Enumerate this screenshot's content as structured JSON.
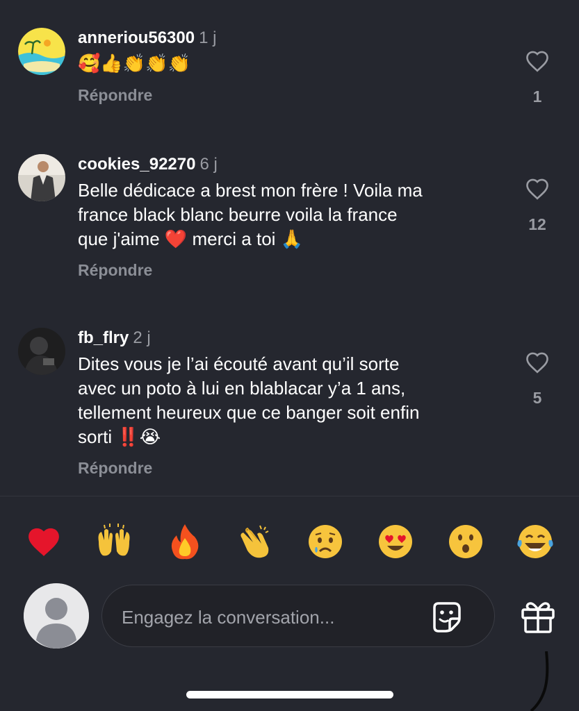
{
  "comments": [
    {
      "username": "anneriou56300",
      "time": "1 j",
      "text": "🥰👍👏👏👏",
      "reply_label": "Répondre",
      "likes": "1"
    },
    {
      "username": "cookies_92270",
      "time": "6 j",
      "text": "Belle dédicace a brest mon frère ! Voila ma\nfrance black blanc beurre voila la france\nque j'aime ❤️ merci a toi 🙏",
      "reply_label": "Répondre",
      "likes": "12"
    },
    {
      "username": "fb_flry",
      "time": "2 j",
      "text": "Dites vous je l’ai écouté avant qu’il sorte\navec un poto à lui en blablacar y’a 1 ans,\ntellement heureux que ce banger soit enfin\nsorti ‼️😭",
      "reply_label": "Répondre",
      "likes": "5"
    }
  ],
  "quick_reactions": [
    "❤️",
    "🙌",
    "🔥",
    "👏",
    "😢",
    "😍",
    "😮",
    "😂"
  ],
  "composer": {
    "placeholder": "Engagez la conversation..."
  },
  "icons": {
    "like": "heart-outline-icon",
    "sticker": "sticker-icon",
    "gift": "gift-icon",
    "profile": "default-avatar-icon"
  },
  "colors": {
    "background": "#25272f",
    "muted_text": "#9a9ca3",
    "reply_text": "#8b8e96"
  }
}
